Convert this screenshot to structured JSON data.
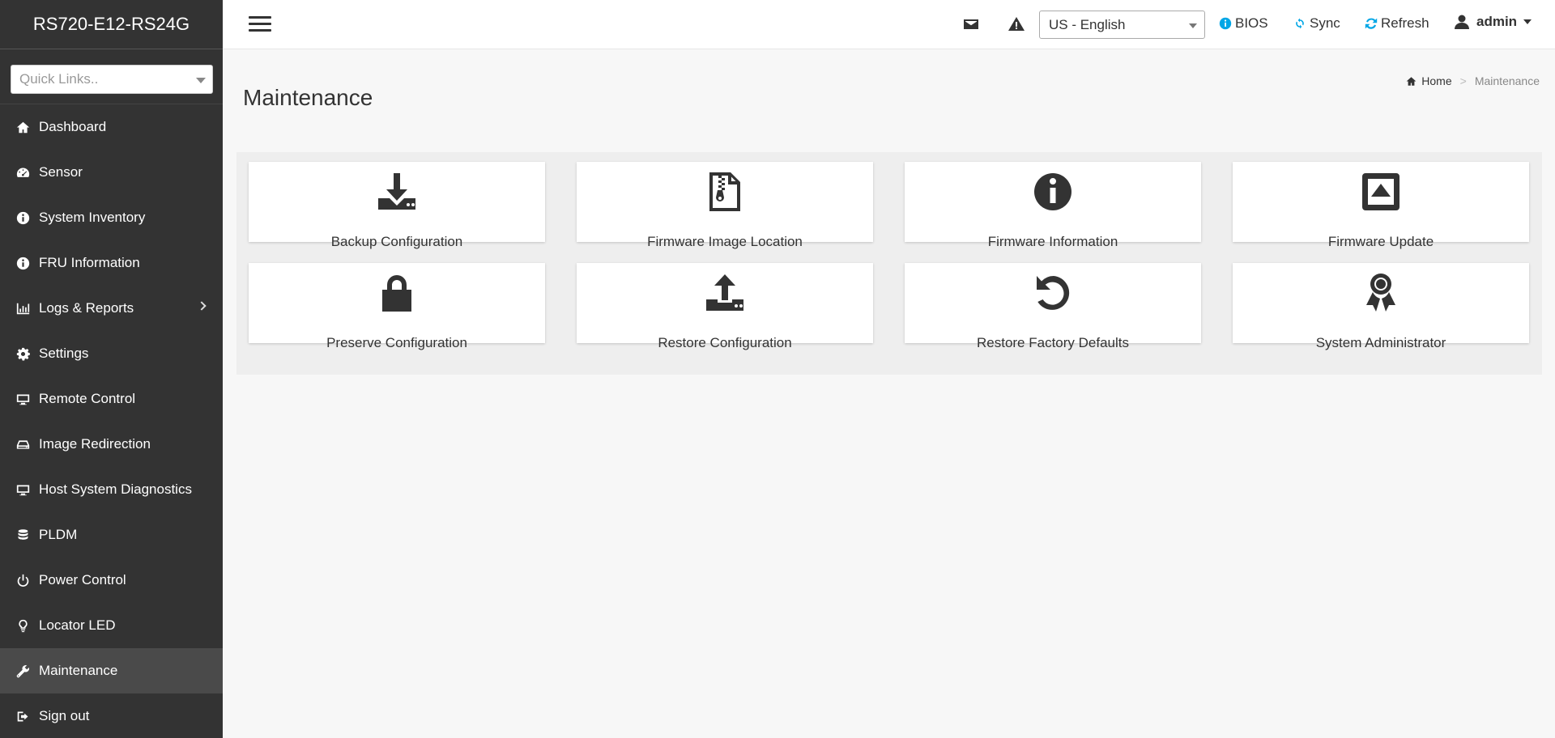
{
  "sidebar": {
    "brand": "RS720-E12-RS24G",
    "quick_links_placeholder": "Quick Links..",
    "items": [
      {
        "label": "Dashboard",
        "icon": "home-icon"
      },
      {
        "label": "Sensor",
        "icon": "dashboard-gauge-icon"
      },
      {
        "label": "System Inventory",
        "icon": "info-circle-icon"
      },
      {
        "label": "FRU Information",
        "icon": "info-circle-icon"
      },
      {
        "label": "Logs & Reports",
        "icon": "bar-chart-icon"
      },
      {
        "label": "Settings",
        "icon": "gear-icon"
      },
      {
        "label": "Remote Control",
        "icon": "monitor-icon"
      },
      {
        "label": "Image Redirection",
        "icon": "drive-icon"
      },
      {
        "label": "Host System Diagnostics",
        "icon": "monitor-icon"
      },
      {
        "label": "PLDM",
        "icon": "database-icon"
      },
      {
        "label": "Power Control",
        "icon": "power-icon"
      },
      {
        "label": "Locator LED",
        "icon": "lightbulb-icon"
      },
      {
        "label": "Maintenance",
        "icon": "wrench-icon"
      },
      {
        "label": "Sign out",
        "icon": "sign-out-icon"
      }
    ],
    "active": "Maintenance"
  },
  "header": {
    "language": "US - English",
    "bios_label": "BIOS",
    "sync_label": "Sync",
    "refresh_label": "Refresh",
    "user": "admin",
    "accent_color": "#00a6e6"
  },
  "breadcrumb": {
    "home": "Home",
    "separator": ">",
    "current": "Maintenance"
  },
  "main": {
    "title": "Maintenance",
    "tiles": [
      {
        "label": "Backup Configuration",
        "icon": "download-tray-icon"
      },
      {
        "label": "Firmware Image Location",
        "icon": "zip-file-icon"
      },
      {
        "label": "Firmware Information",
        "icon": "info-circle-icon"
      },
      {
        "label": "Firmware Update",
        "icon": "eject-square-icon"
      },
      {
        "label": "Preserve Configuration",
        "icon": "lock-icon"
      },
      {
        "label": "Restore Configuration",
        "icon": "upload-tray-icon"
      },
      {
        "label": "Restore Factory Defaults",
        "icon": "undo-icon"
      },
      {
        "label": "System Administrator",
        "icon": "award-ribbon-icon"
      }
    ]
  }
}
